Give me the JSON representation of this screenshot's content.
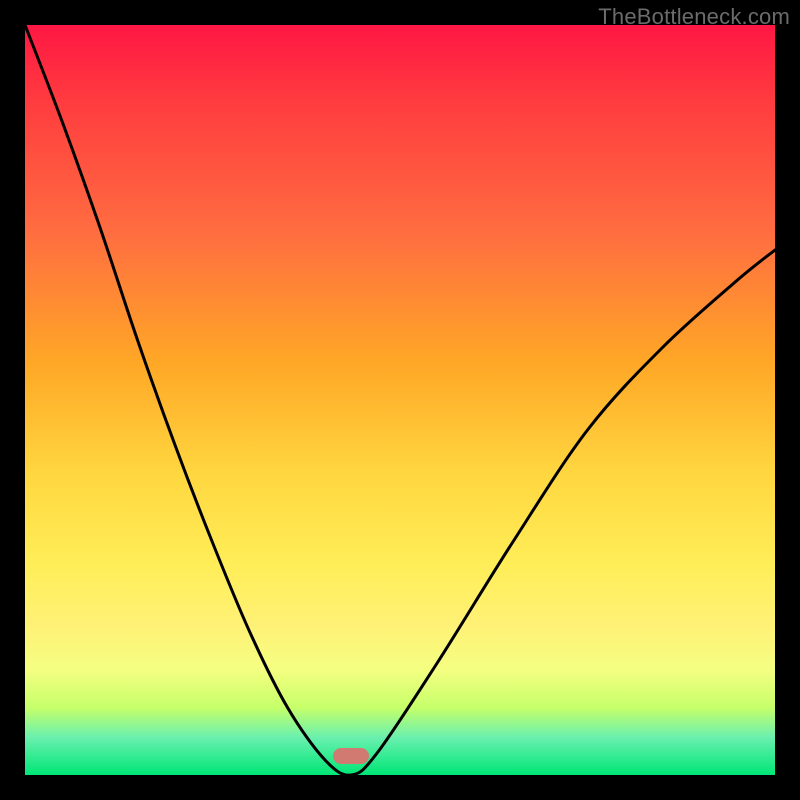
{
  "watermark": "TheBottleneck.com",
  "gradient_colors": {
    "top": "#ff1744",
    "mid_upper": "#ffa726",
    "mid": "#ffee58",
    "mid_lower": "#c6ff6a",
    "bottom": "#00e676"
  },
  "curve": {
    "stroke": "#000000",
    "stroke_width": 3
  },
  "marker": {
    "x_frac": 0.435,
    "y_frac": 0.975,
    "color": "#d17a72"
  },
  "chart_data": {
    "type": "line",
    "title": "",
    "xlabel": "",
    "ylabel": "",
    "x": [
      0.0,
      0.05,
      0.1,
      0.15,
      0.2,
      0.25,
      0.3,
      0.35,
      0.4,
      0.435,
      0.47,
      0.55,
      0.65,
      0.75,
      0.85,
      0.95,
      1.0
    ],
    "values": [
      1.0,
      0.87,
      0.73,
      0.58,
      0.44,
      0.31,
      0.19,
      0.09,
      0.02,
      0.0,
      0.03,
      0.15,
      0.31,
      0.46,
      0.57,
      0.66,
      0.7
    ],
    "xlim": [
      0,
      1
    ],
    "ylim": [
      0,
      1
    ],
    "annotations": [
      {
        "type": "marker",
        "x": 0.435,
        "y": 0.0,
        "label": ""
      }
    ],
    "notes": "values expressed as fraction of plot height from bottom (0=bottom green, 1=top red); x as fraction of plot width"
  }
}
